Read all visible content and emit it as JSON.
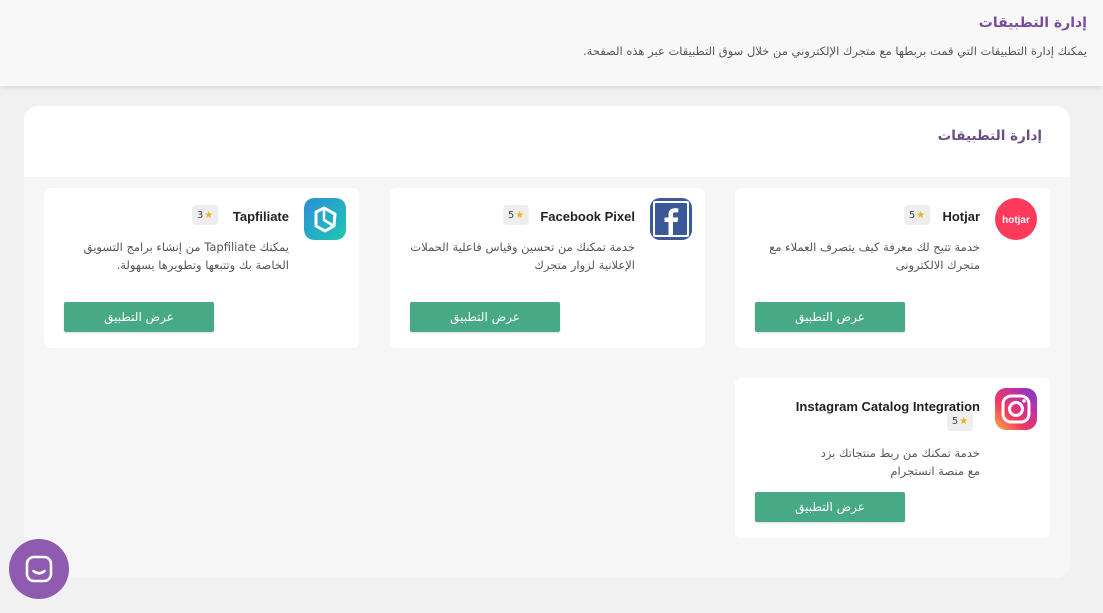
{
  "header": {
    "title": "إدارة التطبيقات",
    "subtitle": "يمكنك إدارة التطبيقات التي قمت بربطها مع متجرك الإلكتروني من خلال سوق التطبيقات عبر هذه الصفحة."
  },
  "panel": {
    "title": "إدارة التطبيقات"
  },
  "colors": {
    "accent": "#7b4c9c",
    "button": "#48a987",
    "star": "#f2b01e"
  },
  "apps": [
    {
      "name": "Hotjar",
      "rating": "5",
      "description": "خدمة تتيح لك معرفة كيف يتصرف العملاء مع متجرك الالكترونى",
      "button_label": "عرض التطبيق",
      "icon": "hotjar-logo"
    },
    {
      "name": "Facebook Pixel",
      "rating": "5",
      "description": "خدمة تمكنك من تحسين وقياس فاعلية الحملات الإعلانية لزوار متجرك",
      "button_label": "عرض التطبيق",
      "icon": "facebook-logo"
    },
    {
      "name": "Tapfiliate",
      "rating": "3",
      "description": "يمكنك Tapfiliate من إنشاء برامج التسويق الخاصة بك وتتبعها وتطويرها بسهولة.",
      "button_label": "عرض التطبيق",
      "icon": "tapfiliate-logo"
    },
    {
      "name": "Instagram Catalog Integration",
      "rating": "5",
      "description": "خدمة تمكنك من ربط منتجاتك بزد مع منصة انستجرام",
      "button_label": "عرض التطبيق",
      "icon": "instagram-logo"
    }
  ],
  "chat": {
    "icon": "chat-bubble-icon"
  }
}
